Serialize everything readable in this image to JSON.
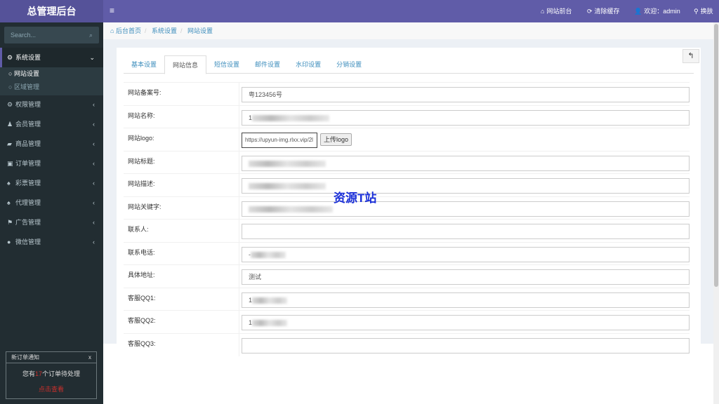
{
  "app": {
    "title": "总管理后台",
    "watermark": "资源T站"
  },
  "topnav": {
    "frontend": "网站前台",
    "clear_cache": "清除缓存",
    "welcome": "欢迎：admin",
    "skin": "换肤"
  },
  "sidebar": {
    "search_placeholder": "Search...",
    "items": [
      {
        "label": "系统设置",
        "icon": "gear-icon"
      },
      {
        "label": "权限管理",
        "icon": "cogs-icon"
      },
      {
        "label": "会员管理",
        "icon": "user-icon"
      },
      {
        "label": "商品管理",
        "icon": "book-icon"
      },
      {
        "label": "订单管理",
        "icon": "money-icon"
      },
      {
        "label": "彩票管理",
        "icon": "bell-icon"
      },
      {
        "label": "代理管理",
        "icon": "bell-icon"
      },
      {
        "label": "广告管理",
        "icon": "flag-icon"
      },
      {
        "label": "微信管理",
        "icon": "wechat-icon"
      }
    ],
    "submenu": [
      "网站设置",
      "区域管理"
    ]
  },
  "notice": {
    "title": "新订单通知",
    "close": "x",
    "prefix": "您有",
    "count": "17",
    "suffix": "个订单待处理",
    "link": "点击查看"
  },
  "breadcrumb": [
    "后台首页",
    "系统设置",
    "网站设置"
  ],
  "tabs": [
    "基本设置",
    "网站信息",
    "短信设置",
    "邮件设置",
    "水印设置",
    "分销设置"
  ],
  "active_tab": "网站信息",
  "form": {
    "upload_label": "上传logo",
    "rows": [
      {
        "label": "网站备案号:",
        "value": "粤123456号"
      },
      {
        "label": "网站名称:",
        "value": "1"
      },
      {
        "label": "网站logo:",
        "value": "https://upyun-img.rlxx.vip/2l"
      },
      {
        "label": "网站标题:",
        "value": ""
      },
      {
        "label": "网站描述:",
        "value": ""
      },
      {
        "label": "网站关键字:",
        "value": ""
      },
      {
        "label": "联系人:",
        "value": ""
      },
      {
        "label": "联系电话:",
        "value": "-"
      },
      {
        "label": "具体地址:",
        "value": "测试"
      },
      {
        "label": "客服QQ1:",
        "value": "1"
      },
      {
        "label": "客服QQ2:",
        "value": "1"
      },
      {
        "label": "客服QQ3:",
        "value": ""
      }
    ]
  }
}
